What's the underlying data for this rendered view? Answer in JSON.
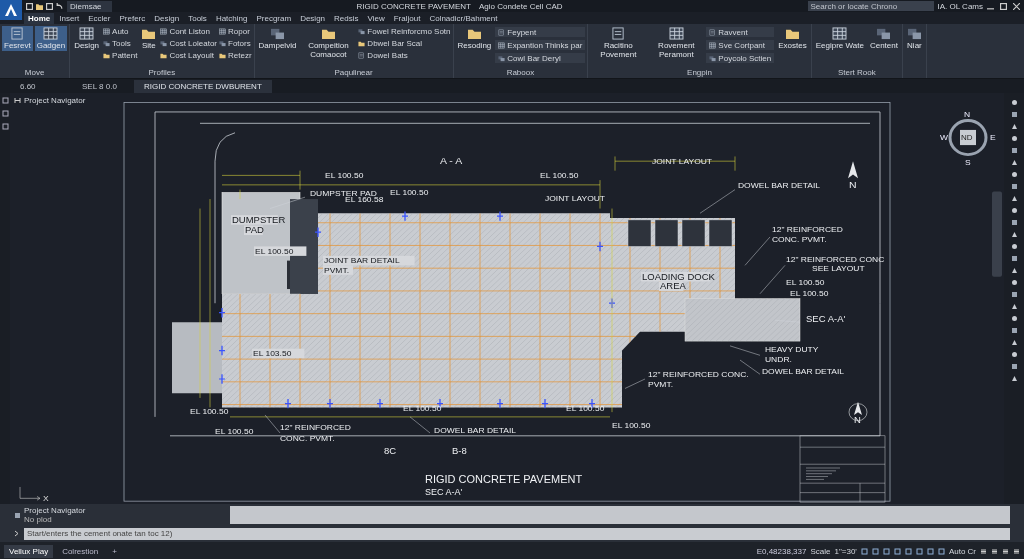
{
  "title_bar": {
    "workspace": "Diemsae",
    "document_title": "RIGID CONCRETE PAVEMENT",
    "app_title": "Agio Condete Cell CAD",
    "search": {
      "placeholder": "Search or locate Chrono"
    },
    "user": "IA. OL Cams"
  },
  "ribbon_tabs": [
    {
      "label": "Home",
      "selected": true
    },
    {
      "label": "Insert",
      "selected": false
    },
    {
      "label": "Eccler",
      "selected": false
    },
    {
      "label": "Preferc",
      "selected": false
    },
    {
      "label": "Design",
      "selected": false
    },
    {
      "label": "Tools",
      "selected": false
    },
    {
      "label": "Hatching",
      "selected": false
    },
    {
      "label": "Precgram",
      "selected": false
    },
    {
      "label": "Design",
      "selected": false
    },
    {
      "label": "Redsis",
      "selected": false
    },
    {
      "label": "View",
      "selected": false
    },
    {
      "label": "Fraljout",
      "selected": false
    },
    {
      "label": "Colnadicr/Bahment",
      "selected": false
    }
  ],
  "ribbon_panels": [
    {
      "title": "Move",
      "items": [
        {
          "kind": "large",
          "label": "Fesrevt",
          "active": true
        },
        {
          "kind": "large",
          "label": "Gadgen",
          "active": true
        }
      ]
    },
    {
      "title": "Profiles",
      "items": [
        {
          "kind": "large",
          "label": "Design",
          "active": false
        },
        {
          "kind": "stack",
          "entries": [
            "Auto",
            "Tools",
            "Pattent"
          ]
        },
        {
          "kind": "large",
          "label": "Site",
          "active": false
        },
        {
          "kind": "stack",
          "entries": [
            "Cont Liston",
            "Cost Loleator",
            "Cost Layoult"
          ]
        },
        {
          "kind": "stack",
          "entries": [
            "Ropor",
            "Fotors",
            "Retezr"
          ]
        }
      ]
    },
    {
      "title": "Paqulinear",
      "items": [
        {
          "kind": "large",
          "label": "Dampelvid",
          "active": false
        },
        {
          "kind": "large",
          "label": "Compeition Comaocot",
          "active": false
        },
        {
          "kind": "stack",
          "entries": [
            "Fowel Reinforcmo Sotn",
            "Dbwel Bar Scal",
            "Dowel Bats"
          ]
        }
      ]
    },
    {
      "title": "Raboox",
      "items": [
        {
          "kind": "large",
          "label": "Resoding",
          "active": false
        },
        {
          "kind": "combos",
          "entries": [
            "Feypent",
            "Expantion Thinks par",
            "Cowl Bar Deryl"
          ]
        }
      ]
    },
    {
      "title": "Engpin",
      "items": [
        {
          "kind": "large",
          "label": "Racitino Povement",
          "active": false
        },
        {
          "kind": "large",
          "label": "Rovement Peramont",
          "active": false
        },
        {
          "kind": "combos",
          "entries": [
            "Ravvent",
            "Sve Cortpant",
            "Poycolo Sctien"
          ]
        },
        {
          "kind": "large",
          "label": "Exostes",
          "active": false
        }
      ]
    },
    {
      "title": "Stert Rook",
      "items": [
        {
          "kind": "large",
          "label": "Eegipre Wate",
          "active": false
        },
        {
          "kind": "large",
          "label": "Centent",
          "active": false
        }
      ]
    },
    {
      "items": [
        {
          "kind": "large",
          "label": "Niar",
          "active": false
        }
      ]
    }
  ],
  "document_tabs": [
    {
      "label": "6.60",
      "selected": false
    },
    {
      "label": "SEL 8 0.0",
      "selected": false
    },
    {
      "label": "RIGID CONCRETE DWBURENT",
      "selected": true
    }
  ],
  "navigator_header": "Project Navigator",
  "view_cube": {
    "north": "N",
    "west": "W",
    "east": "E",
    "south": "S",
    "face": "ND"
  },
  "drawing": {
    "labels": [
      "EL 100.50",
      "EL 100.50",
      "A - A",
      "DUMPSTER PAD",
      "JOINT LAYOUT",
      "JOINT LAYOUT",
      "DOWEL BAR DETAIL",
      "EL 160.58",
      "EL 100.50",
      "DUMPSTER",
      "PAD",
      "EL 100.50",
      "12\" REINFORCED",
      "CONC. PVMT.",
      "12\" REINFORCED CONC",
      "SEE LAYOUT",
      "JOINT BAR DETAIL",
      "PVMT.",
      "LOADING DOCK",
      "AREA",
      "EL 100.50",
      "EL 100.50",
      "SEC A-A'",
      "EL 103.50",
      "HEAVY DUTY",
      "UNDR.",
      "DOWEL BAR DETAIL",
      "12\" REINFORCED CONC.",
      "PVMT.",
      "EL 100.50",
      "EL 100.50",
      "EL 100.50",
      "EL 100.50",
      "EL 100.50",
      "12\" REINFORCED",
      "CONC. PVMT.",
      "DOWEL BAR DETAIL",
      "8C",
      "B-8",
      "N",
      "N"
    ],
    "title": "RIGID CONCRETE PAVEMENT",
    "subtitle": "SEC A-A'",
    "ucs_axis": "X"
  },
  "command_line": {
    "palette_title": "Project Navigator",
    "palette_subtitle": "No plod",
    "placeholder": "Start/enters the cement onate tan toc 12)"
  },
  "layout_tabs": [
    {
      "label": "Vellux Play",
      "selected": true
    },
    {
      "label": "Colrestion",
      "selected": false
    },
    {
      "label": "+",
      "selected": false
    }
  ],
  "status_bar": {
    "coordinates": "E0,48238,337",
    "scale_label": "Scale",
    "scale_value": "1\"=30'",
    "annotation": "Auto Cr"
  }
}
